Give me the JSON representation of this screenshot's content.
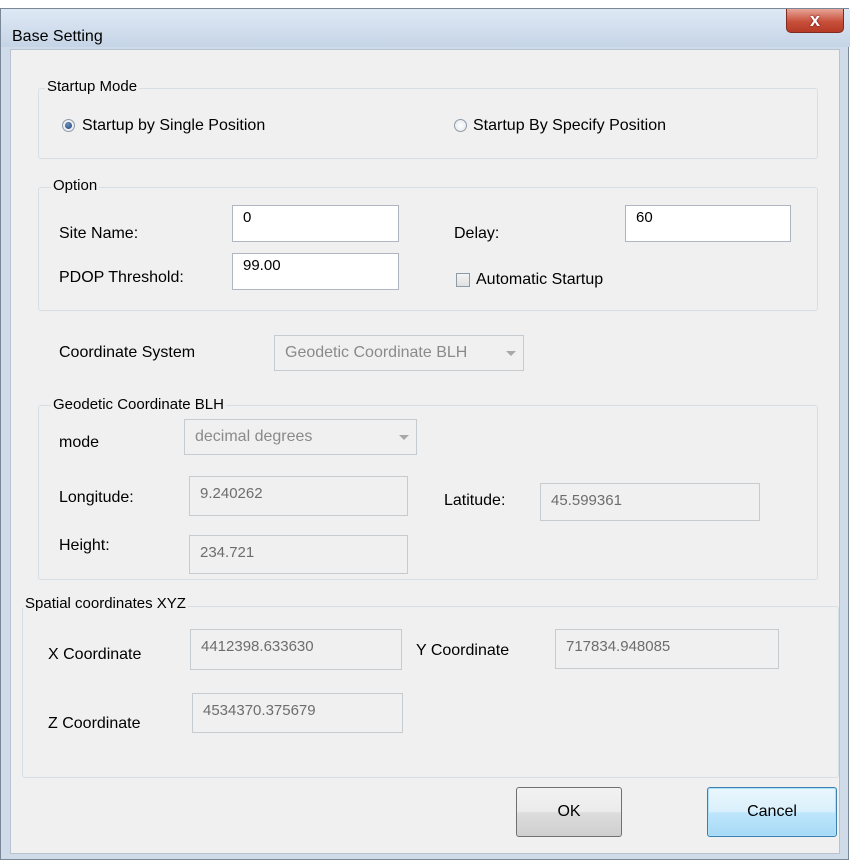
{
  "window": {
    "title": "Base Setting",
    "close_glyph": "x"
  },
  "startup_mode": {
    "legend": "Startup Mode",
    "options": [
      {
        "label": "Startup by Single Position",
        "checked": true
      },
      {
        "label": "Startup By Specify Position",
        "checked": false
      }
    ]
  },
  "option": {
    "legend": "Option",
    "site_name_label": "Site Name:",
    "site_name_value": "0",
    "delay_label": "Delay:",
    "delay_value": "60",
    "pdop_label": "PDOP Threshold:",
    "pdop_value": "99.00",
    "auto_startup_label": "Automatic Startup",
    "auto_startup_checked": false
  },
  "coordinate_system": {
    "label": "Coordinate System",
    "value": "Geodetic Coordinate BLH"
  },
  "geodetic": {
    "legend": "Geodetic Coordinate BLH",
    "mode_label": "mode",
    "mode_value": "decimal degrees",
    "longitude_label": "Longitude:",
    "longitude_value": "9.240262",
    "latitude_label": "Latitude:",
    "latitude_value": "45.599361",
    "height_label": "Height:",
    "height_value": "234.721"
  },
  "spatial": {
    "legend": "Spatial coordinates XYZ",
    "x_label": "X Coordinate",
    "x_value": "4412398.633630",
    "y_label": "Y Coordinate",
    "y_value": "717834.948085",
    "z_label": "Z Coordinate",
    "z_value": "4534370.375679"
  },
  "buttons": {
    "ok": "OK",
    "cancel": "Cancel"
  }
}
